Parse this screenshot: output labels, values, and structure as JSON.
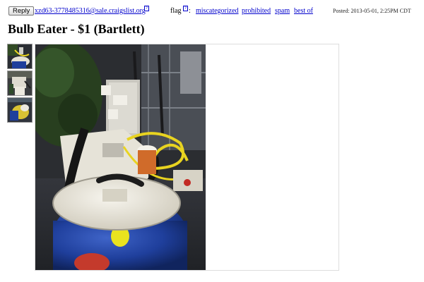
{
  "header": {
    "reply_label": "Reply",
    "reply_email": "xzd63-3778485316@sale.craigslist.org",
    "help_mark": "?",
    "flag_label": "flag",
    "flag_colon": ":",
    "flag_links": [
      "miscategorized",
      "prohibited",
      "spam",
      "best of"
    ],
    "posted": "Posted: 2013-05-01, 2:25PM CDT"
  },
  "listing": {
    "title": "Bulb Eater - $1 (Bartlett)"
  },
  "gallery": {
    "thumbnails": [
      "thumbnail-1",
      "thumbnail-2",
      "thumbnail-3"
    ],
    "selected_thumbnail": 0,
    "main_image": "bulb-eater-drum-vacuum-photo"
  },
  "colors": {
    "link": "#0000cc",
    "drum_blue": "#1f3f9c",
    "cord_yellow": "#e8d320",
    "lid_cream": "#ece9df"
  }
}
